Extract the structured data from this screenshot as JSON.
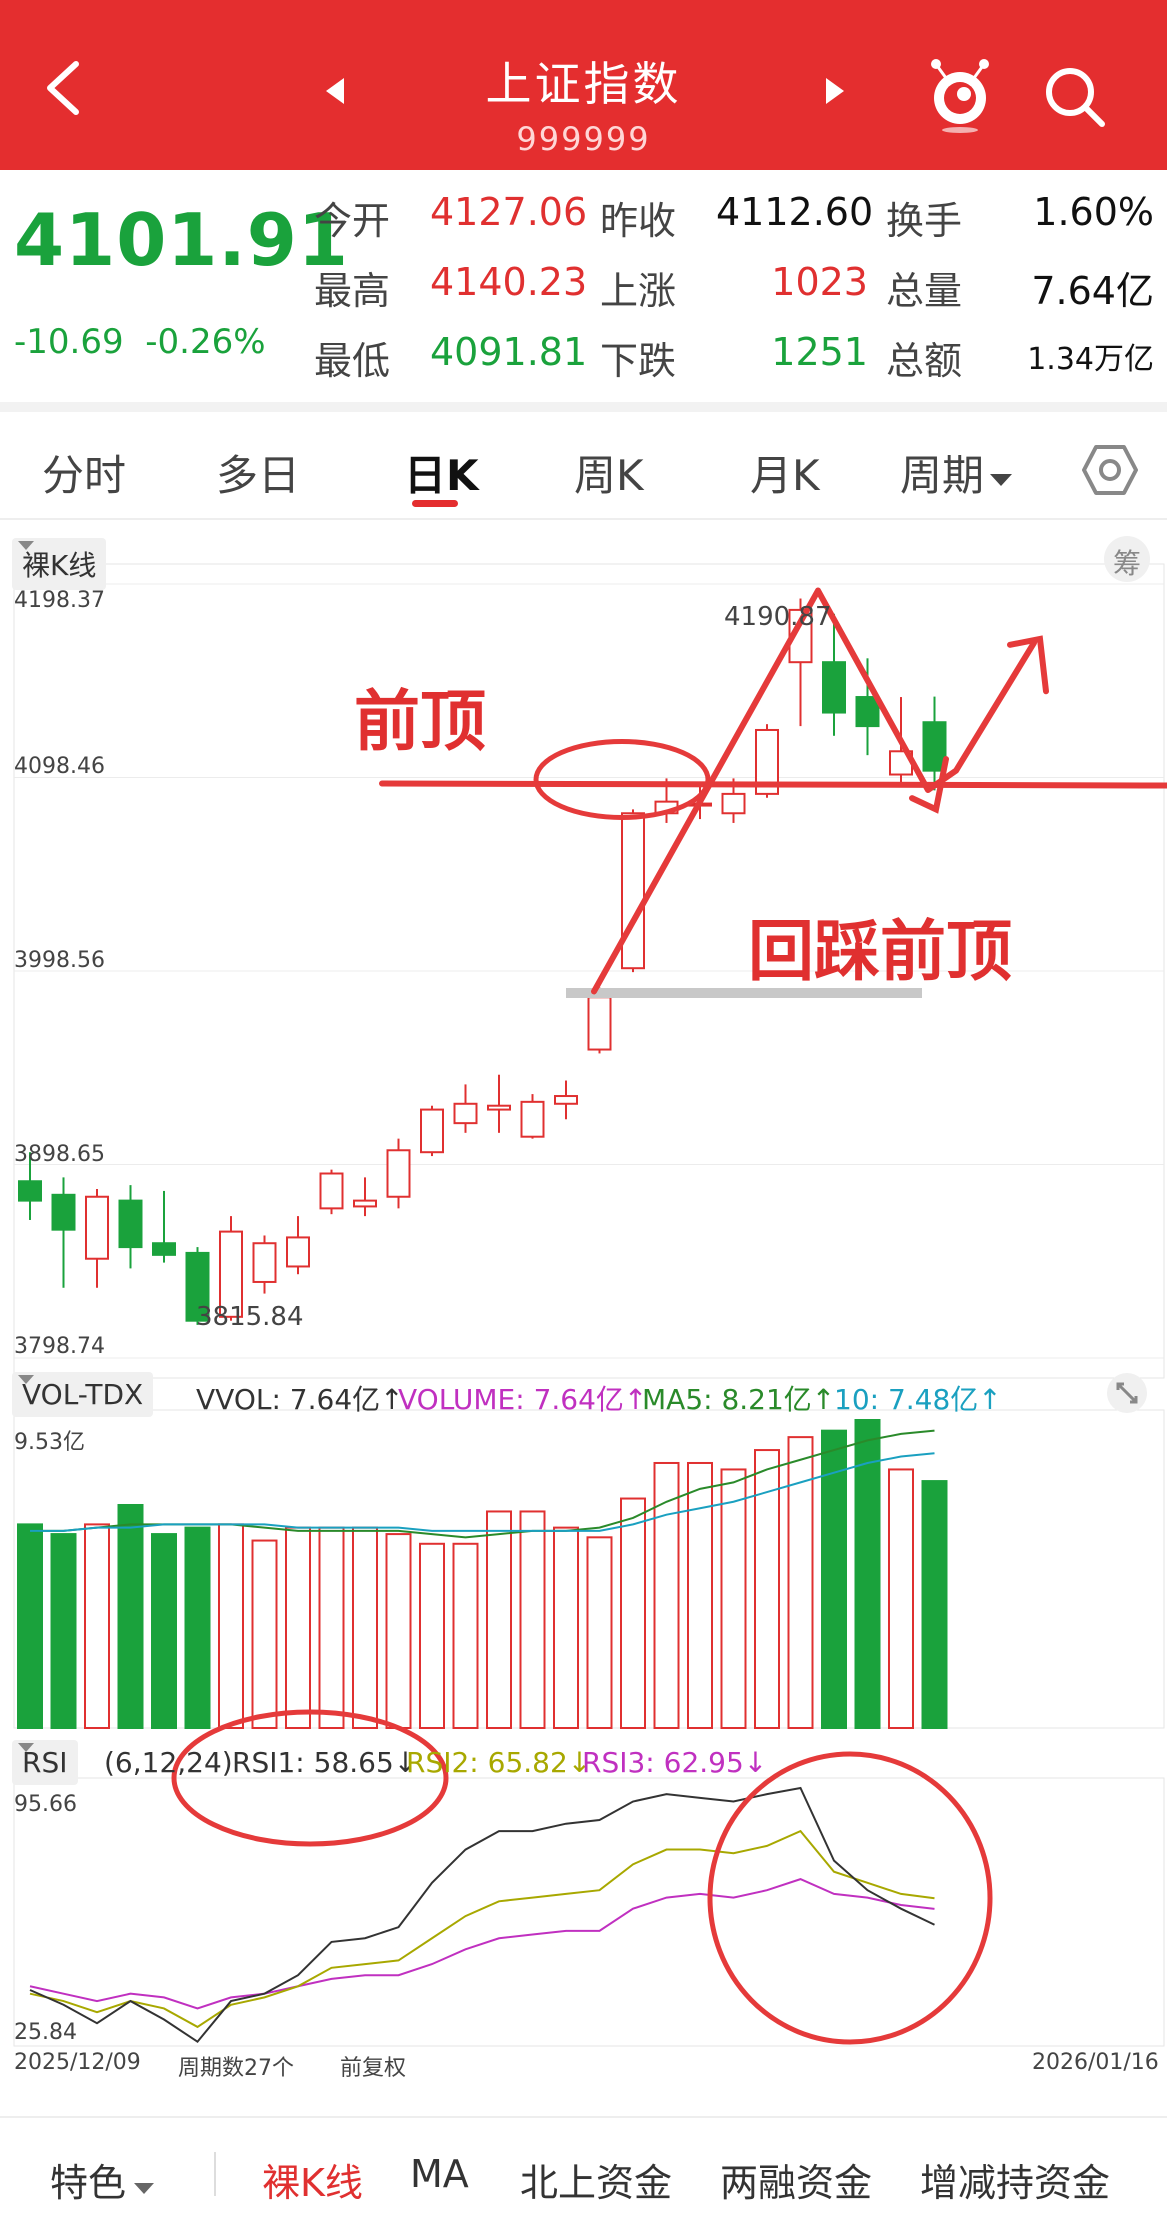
{
  "header": {
    "title": "上证指数",
    "code": "999999"
  },
  "quote": {
    "price": "4101.91",
    "change": "-10.69",
    "change_pct": "-0.26%",
    "rows": [
      {
        "l1": "今开",
        "v1": "4127.06",
        "l2": "昨收",
        "v2": "4112.60",
        "l3": "换手",
        "v3": "1.60%"
      },
      {
        "l1": "最高",
        "v1": "4140.23",
        "l2": "上涨",
        "v2": "1023",
        "l3": "总量",
        "v3": "7.64亿"
      },
      {
        "l1": "最低",
        "v1": "4091.81",
        "l2": "下跌",
        "v2": "1251",
        "l3": "总额",
        "v3": "1.34万亿"
      }
    ]
  },
  "tabs": [
    "分时",
    "多日",
    "日K",
    "周K",
    "月K",
    "周期"
  ],
  "active_tab": "日K",
  "kline": {
    "tag": "裸K线",
    "chip_icon": "筹",
    "price_labels": [
      "4198.37",
      "4098.46",
      "3998.56",
      "3898.65",
      "3798.74"
    ],
    "high_label": "4190.87",
    "low_label": "3815.84",
    "annotation_top": "前顶",
    "annotation_bottom": "回踩前顶"
  },
  "volume": {
    "tag": "VOL-TDX",
    "legend": [
      {
        "text": "VVOL: 7.64亿↑",
        "color": "#333333"
      },
      {
        "text": "VOLUME: 7.64亿↑",
        "color": "#c030c0"
      },
      {
        "text": "MA5: 8.21亿↑",
        "color": "#2a8a2a"
      },
      {
        "text": "10: 7.48亿↑",
        "color": "#1aa0c0"
      }
    ],
    "max_label": "9.53亿"
  },
  "rsi": {
    "tag": "RSI",
    "params": "(6,12,24)",
    "legend": [
      {
        "text": "RSI1: 58.65↓",
        "color": "#333333"
      },
      {
        "text": "RSI2: 65.82↓",
        "color": "#a8a800"
      },
      {
        "text": "RSI3: 62.95↓",
        "color": "#c030c0"
      }
    ],
    "top_label": "95.66",
    "bottom_label": "25.84"
  },
  "footer_axis": {
    "start_date": "2025/12/09",
    "period_count": "周期数27个",
    "adjust": "前复权",
    "end_date": "2026/01/16"
  },
  "bottom_tabs": [
    "特色",
    "裸K线",
    "MA",
    "北上资金",
    "两融资金",
    "增减持资金"
  ],
  "active_bottom_tab": "裸K线",
  "colors": {
    "header_red": "#e42e2f",
    "up_red": "#e03030",
    "down_green": "#1aa23c"
  },
  "chart_data": {
    "type": "candlestick",
    "x_start": "2025/12/09",
    "x_end": "2026/01/16",
    "ylim": [
      3798.74,
      4198.37
    ],
    "candles": [
      {
        "o": 3890,
        "c": 3880,
        "h": 3905,
        "l": 3870
      },
      {
        "o": 3883,
        "c": 3865,
        "h": 3892,
        "l": 3835
      },
      {
        "o": 3850,
        "c": 3882,
        "h": 3886,
        "l": 3835
      },
      {
        "o": 3880,
        "c": 3856,
        "h": 3888,
        "l": 3845
      },
      {
        "o": 3858,
        "c": 3852,
        "h": 3885,
        "l": 3848
      },
      {
        "o": 3853,
        "c": 3818,
        "h": 3856,
        "l": 3815.84
      },
      {
        "o": 3820,
        "c": 3864,
        "h": 3872,
        "l": 3818
      },
      {
        "o": 3838,
        "c": 3858,
        "h": 3862,
        "l": 3832
      },
      {
        "o": 3846,
        "c": 3861,
        "h": 3872,
        "l": 3842
      },
      {
        "o": 3876,
        "c": 3894,
        "h": 3896,
        "l": 3873
      },
      {
        "o": 3877,
        "c": 3880,
        "h": 3892,
        "l": 3872
      },
      {
        "o": 3882,
        "c": 3906,
        "h": 3912,
        "l": 3876
      },
      {
        "o": 3905,
        "c": 3927,
        "h": 3929,
        "l": 3903
      },
      {
        "o": 3920,
        "c": 3930,
        "h": 3940,
        "l": 3915
      },
      {
        "o": 3927,
        "c": 3929,
        "h": 3945,
        "l": 3915
      },
      {
        "o": 3913,
        "c": 3931,
        "h": 3935,
        "l": 3912
      },
      {
        "o": 3930,
        "c": 3934,
        "h": 3942,
        "l": 3922
      },
      {
        "o": 3958,
        "c": 3985,
        "h": 3990,
        "l": 3956
      },
      {
        "o": 4000,
        "c": 4080,
        "h": 4082,
        "l": 3998
      },
      {
        "o": 4080,
        "c": 4086,
        "h": 4098,
        "l": 4075
      },
      {
        "o": 4084,
        "c": 4085,
        "h": 4095,
        "l": 4077
      },
      {
        "o": 4080,
        "c": 4090,
        "h": 4098,
        "l": 4075
      },
      {
        "o": 4090,
        "c": 4123,
        "h": 4126,
        "l": 4088
      },
      {
        "o": 4158,
        "c": 4185,
        "h": 4190.87,
        "l": 4125
      },
      {
        "o": 4158,
        "c": 4132,
        "h": 4183,
        "l": 4120
      },
      {
        "o": 4140,
        "c": 4125,
        "h": 4160,
        "l": 4110
      },
      {
        "o": 4100,
        "c": 4112,
        "h": 4140,
        "l": 4095
      },
      {
        "o": 4127,
        "c": 4102,
        "h": 4140.23,
        "l": 4091.81
      }
    ],
    "volume": {
      "ylim": [
        0,
        9.53
      ],
      "values": [
        6.3,
        6.0,
        6.3,
        6.9,
        6.0,
        6.2,
        6.3,
        5.8,
        6.2,
        6.2,
        6.2,
        6.0,
        5.7,
        5.7,
        6.7,
        6.7,
        6.2,
        5.9,
        7.1,
        8.2,
        8.2,
        8.0,
        8.6,
        9.0,
        9.2,
        9.53,
        8.0,
        7.64
      ],
      "ma5": [
        6.1,
        6.1,
        6.2,
        6.3,
        6.3,
        6.3,
        6.3,
        6.2,
        6.1,
        6.1,
        6.1,
        6.1,
        6.0,
        5.9,
        6.0,
        6.1,
        6.1,
        6.2,
        6.5,
        7.0,
        7.4,
        7.6,
        8.0,
        8.3,
        8.6,
        8.9,
        9.1,
        9.2
      ],
      "ma10": [
        6.1,
        6.1,
        6.2,
        6.2,
        6.3,
        6.3,
        6.3,
        6.3,
        6.2,
        6.2,
        6.2,
        6.2,
        6.1,
        6.1,
        6.1,
        6.1,
        6.1,
        6.1,
        6.3,
        6.6,
        6.8,
        7.0,
        7.3,
        7.6,
        7.9,
        8.2,
        8.4,
        8.5
      ]
    },
    "rsi": {
      "ylim": [
        25.84,
        95.66
      ],
      "rsi1": [
        41,
        37,
        32,
        38,
        33,
        27,
        38,
        40,
        45,
        54,
        55,
        58,
        70,
        79,
        84,
        84,
        86,
        87,
        92,
        94,
        93,
        92,
        94,
        95.66,
        76,
        68,
        63,
        58.65
      ],
      "rsi2": [
        40,
        38,
        35,
        38,
        36,
        31,
        37,
        39,
        42,
        47,
        48,
        49,
        55,
        61,
        65,
        66,
        67,
        68,
        75,
        79,
        79,
        78,
        80,
        84,
        73,
        70,
        67,
        65.82
      ],
      "rsi3": [
        42,
        40,
        38,
        40,
        39,
        36,
        39,
        40,
        42,
        44,
        45,
        45,
        48,
        52,
        55,
        56,
        57,
        57,
        63,
        66,
        67,
        66,
        68,
        71,
        67,
        66,
        64,
        62.95
      ]
    }
  }
}
